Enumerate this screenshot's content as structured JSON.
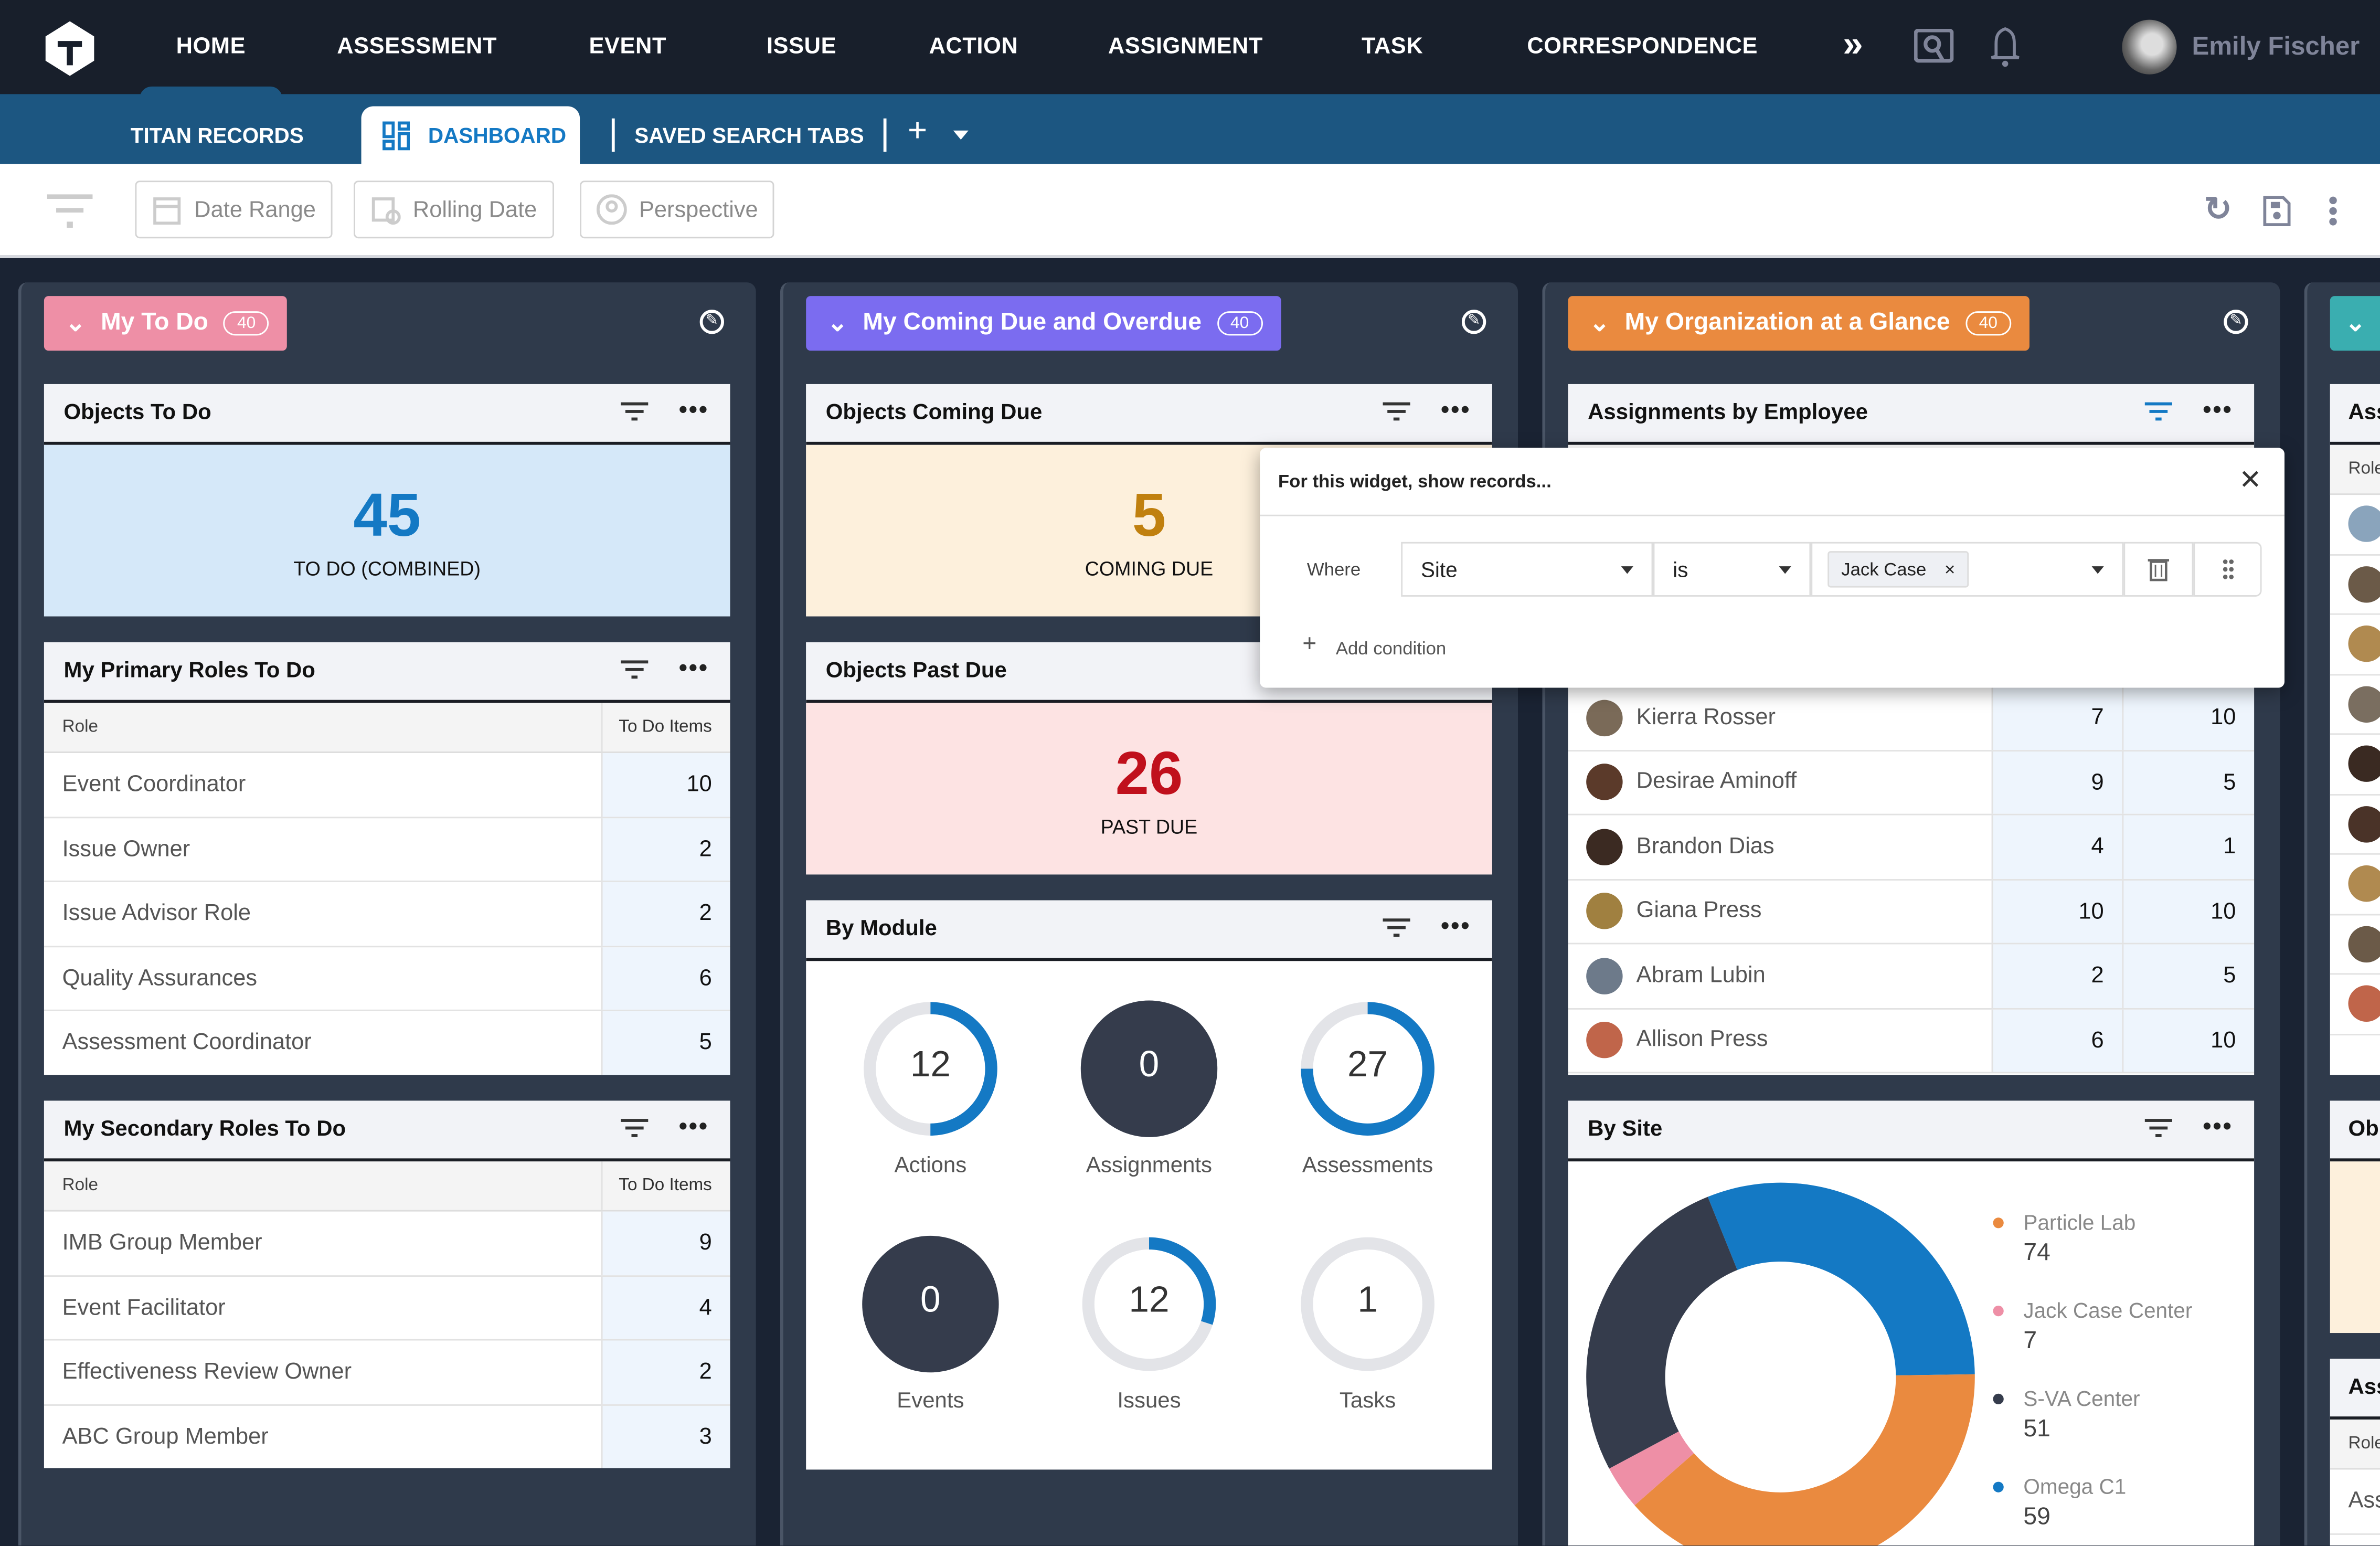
{
  "topnav": {
    "items": [
      "HOME",
      "ASSESSMENT",
      "EVENT",
      "ISSUE",
      "ACTION",
      "ASSIGNMENT",
      "TASK",
      "CORRESPONDENCE"
    ],
    "active": "HOME",
    "user_name": "Emily Fischer"
  },
  "subnav": {
    "titan_records": "TITAN RECORDS",
    "dashboard": "DASHBOARD",
    "saved_search_tabs": "SAVED SEARCH TABS"
  },
  "toolbar": {
    "date_range": "Date Range",
    "rolling_date": "Rolling Date",
    "perspective": "Perspective"
  },
  "colors": {
    "nav_bg": "#181f2b",
    "subnav_bg": "#1c5681",
    "accent": "#1479c4",
    "pink": "#ee8fa6",
    "purple": "#7b6cf0",
    "orange": "#ea8a3f",
    "teal": "#3aaeb0",
    "coming_due": "#c0800f",
    "past_due": "#c0101c"
  },
  "col1": {
    "title": "My To Do",
    "count": "40",
    "objects_to_do": {
      "title": "Objects To Do",
      "value": "45",
      "label": "TO DO (COMBINED)"
    },
    "primary": {
      "title": "My Primary Roles To Do",
      "headers": [
        "Role",
        "To Do Items"
      ],
      "rows": [
        [
          "Event Coordinator",
          "10"
        ],
        [
          "Issue Owner",
          "2"
        ],
        [
          "Issue Advisor Role",
          "2"
        ],
        [
          "Quality Assurances",
          "6"
        ],
        [
          "Assessment Coordinator",
          "5"
        ]
      ]
    },
    "secondary": {
      "title": "My Secondary Roles To Do",
      "headers": [
        "Role",
        "To Do Items"
      ],
      "rows": [
        [
          "IMB Group Member",
          "9"
        ],
        [
          "Event Facilitator",
          "4"
        ],
        [
          "Effectiveness Review Owner",
          "2"
        ],
        [
          "ABC Group Member",
          "3"
        ]
      ]
    }
  },
  "col2": {
    "title": "My Coming Due and Overdue",
    "count": "40",
    "coming": {
      "title": "Objects Coming Due",
      "value": "5",
      "label": "COMING DUE"
    },
    "past": {
      "title": "Objects Past Due",
      "value": "26",
      "label": "PAST DUE"
    },
    "module": {
      "title": "By Module",
      "items": [
        {
          "label": "Actions",
          "value": "12",
          "fill": 0.5,
          "solid": false
        },
        {
          "label": "Assignments",
          "value": "0",
          "fill": 0,
          "solid": true
        },
        {
          "label": "Assessments",
          "value": "27",
          "fill": 0.75,
          "solid": false
        },
        {
          "label": "Events",
          "value": "0",
          "fill": 0,
          "solid": true
        },
        {
          "label": "Issues",
          "value": "12",
          "fill": 0.3,
          "solid": false
        },
        {
          "label": "Tasks",
          "value": "1",
          "fill": 0,
          "solid": false
        }
      ]
    }
  },
  "col3": {
    "title": "My Organization at a Glance",
    "count": "40",
    "employees": {
      "title": "Assignments by Employee",
      "rows": [
        {
          "name": "Kierra Rosser",
          "a": "7",
          "b": "10",
          "avatar": "#7a6a58"
        },
        {
          "name": "Desirae Aminoff",
          "a": "9",
          "b": "5",
          "avatar": "#5b3a2a"
        },
        {
          "name": "Brandon Dias",
          "a": "4",
          "b": "1",
          "avatar": "#3b2a22"
        },
        {
          "name": "Giana Press",
          "a": "10",
          "b": "10",
          "avatar": "#a08040"
        },
        {
          "name": "Abram Lubin",
          "a": "2",
          "b": "5",
          "avatar": "#6d7a8a"
        },
        {
          "name": "Allison Press",
          "a": "6",
          "b": "10",
          "avatar": "#c0654a"
        }
      ]
    },
    "site": {
      "title": "By Site"
    }
  },
  "popover": {
    "title": "For this widget, show records...",
    "where": "Where",
    "field": "Site",
    "operator": "is",
    "value_chip": "Jack Case",
    "add_condition": "Add condition"
  },
  "col4": {
    "header": "Ass",
    "role": "Role",
    "objects": "Ob",
    "assign2": "Ass",
    "role2": "Role",
    "row": "Ass",
    "avatars": [
      "#8aa4bc",
      "#6b5a48",
      "#b08a50",
      "#7a6e60",
      "#3a2a22",
      "#4a3328",
      "#b08a50",
      "#6b5a48",
      "#c0654a"
    ]
  },
  "chart_data": {
    "type": "pie",
    "title": "By Site",
    "donut": true,
    "legend_position": "right",
    "slices": [
      {
        "label": "Particle Lab",
        "value": 74,
        "color": "#ea8a3f"
      },
      {
        "label": "Jack Case Center",
        "value": 7,
        "color": "#ee8fa6"
      },
      {
        "label": "S-VA Center",
        "value": 51,
        "color": "#353c4c"
      },
      {
        "label": "Omega C1",
        "value": 59,
        "color": "#1479c4"
      }
    ]
  }
}
